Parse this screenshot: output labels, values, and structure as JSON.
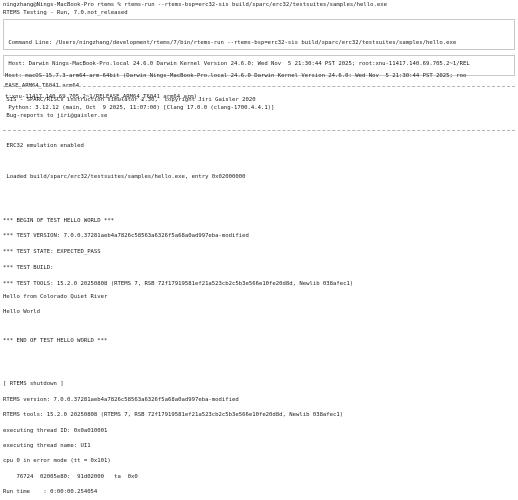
{
  "prompt": {
    "user_host": "ningzhang@Nings-MacBook-Pro rtems % ",
    "command": "rtems-run --rtems-bsp=erc32-sis build/sparc/erc32/testsuites/samples/hello.exe"
  },
  "header": {
    "title": "RTEMS Testing - Run, 7.0.not_released"
  },
  "info_box": {
    "lines": [
      " Command Line: /Users/ningzhang/development/rtems/7/bin/rtems-run --rtems-bsp=erc32-sis build/sparc/erc32/testsuites/samples/hello.exe",
      " Host: Darwin Nings-MacBook-Pro.local 24.6.0 Darwin Kernel Version 24.6.0: Wed Nov  5 21:30:44 PST 2025; root:xnu-11417.140.69.705.2~1/REL",
      "EASE_ARM64_T6041 arm64",
      " Python: 3.12.12 (main, Oct  9 2025, 11:07:00) [Clang 17.0.0 (clang-1700.4.4.1)]"
    ]
  },
  "host_box": {
    "lines": [
      "Host: macOS-15.7.3-arm64-arm-64bit (Darwin Nings-MacBook-Pro.local 24.6.0 Darwin Kernel Version 24.6.0: Wed Nov  5 21:30:44 PST 2025; roo",
      "t:xnu-11417.140.69.705.2~1/RELEASE_ARM64_T6041 arm64 arm)"
    ]
  },
  "sim": {
    "banner": " SIS - SPARC/RISCV instruction simulator 2.30,  copyright Jiri Gaisler 2020",
    "bugs": " Bug-reports to jiri@gaisler.se",
    "emulation": " ERC32 emulation enabled",
    "loaded": " Loaded build/sparc/erc32/testsuites/samples/hello.exe, entry 0x02000000"
  },
  "test": {
    "begin": "*** BEGIN OF TEST HELLO WORLD ***",
    "version": "*** TEST VERSION: 7.0.0.37281aeb4a7826c58563a6326f5a68a0ad997eba-modified",
    "state": "*** TEST STATE: EXPECTED_PASS",
    "build": "*** TEST BUILD:",
    "tools": "*** TEST TOOLS: 15.2.0 20250808 (RTEMS 7, RSB 72f17919581ef21a523cb2c5b3e566e10fe20d8d, Newlib 038afec1)",
    "hello_colorado": "Hello from Colorado Quiet River",
    "hello_world": "Hello World",
    "end": "*** END OF TEST HELLO WORLD ***"
  },
  "shutdown": {
    "header": "[ RTEMS shutdown ]",
    "version": "RTEMS version: 7.0.0.37281aeb4a7826c58563a6326f5a68a0ad997eba-modified",
    "tools": "RTEMS tools: 15.2.0 20250808 (RTEMS 7, RSB 72f17919581ef21a523cb2c5b3e566e10fe20d8d, Newlib 038afec1)",
    "thread_id": "executing thread ID: 0x0a010001",
    "thread_name": "executing thread name: UI1",
    "error_mode": "cpu 0 in error mode (tt = 0x101)",
    "regs": "    76724  02005e80:  91d02000   ta  0x0",
    "run_time": "Run time    : 0:00:00.254054"
  }
}
